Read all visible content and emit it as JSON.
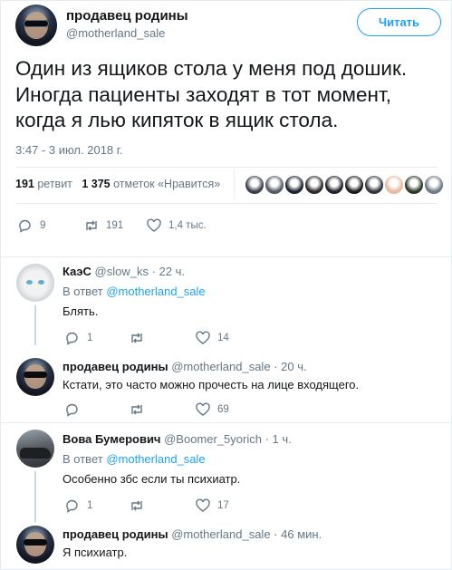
{
  "main_tweet": {
    "display_name": "продавец родины",
    "handle": "@motherland_sale",
    "follow_label": "Читать",
    "text_lines": [
      "Один из ящиков стола у меня под дошик.",
      "Иногда пациенты заходят в тот момент,",
      "когда я лью кипяток в ящик стола."
    ],
    "timestamp": "3:47 - 3 июл. 2018 г.",
    "retweets_count": "191",
    "retweets_label": "ретвит",
    "likes_count": "1 375",
    "likes_label": "отметок «Нравится»",
    "actions": {
      "replies": "9",
      "retweets": "191",
      "likes": "1,4 тыс."
    }
  },
  "likers": [
    {
      "color": "#3b3f4a"
    },
    {
      "color": "#555a66"
    },
    {
      "color": "#1c2430"
    },
    {
      "color": "#2e2a2a"
    },
    {
      "color": "#20222a"
    },
    {
      "color": "#1b1b1b"
    },
    {
      "color": "#33363c"
    },
    {
      "color": "#e6b9a0"
    },
    {
      "color": "#2c3a26"
    },
    {
      "color": "#6e7a84"
    }
  ],
  "replies": [
    {
      "name": "КаэС",
      "handle": "@slow_ks",
      "time": "· 22 ч.",
      "reply_prefix": "В ответ",
      "reply_to": "@motherland_sale",
      "text": "Блять.",
      "replies": "1",
      "retweets": "",
      "likes": "14"
    },
    {
      "name": "продавец родины",
      "handle": "@motherland_sale",
      "time": "· 20 ч.",
      "text": "Кстати, это часто можно прочесть на лице входящего.",
      "replies": "",
      "retweets": "",
      "likes": "69"
    },
    {
      "name": "Вова Бумерович",
      "handle": "@Boomer_5yorich",
      "time": "· 1 ч.",
      "reply_prefix": "В ответ",
      "reply_to": "@motherland_sale",
      "text": "Особенно збс если ты психиатр.",
      "replies": "1",
      "retweets": "",
      "likes": "17"
    },
    {
      "name": "продавец родины",
      "handle": "@motherland_sale",
      "time": "· 46 мин.",
      "text": "Я психиатр."
    }
  ],
  "colors": {
    "accent": "#1da1f2",
    "muted": "#657786",
    "text": "#14171a"
  }
}
